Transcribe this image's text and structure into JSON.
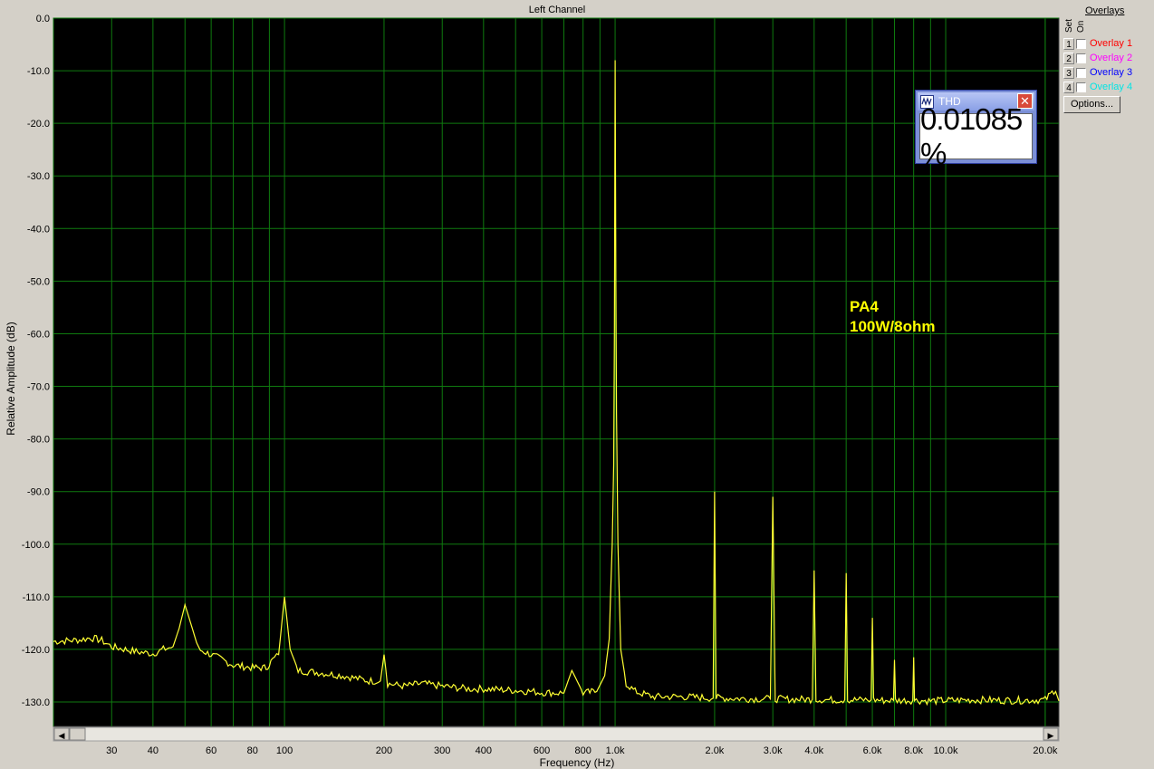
{
  "chart_data": {
    "type": "line",
    "title": "Left Channel",
    "xlabel": "Frequency (Hz)",
    "ylabel": "Relative Amplitude (dB)",
    "x_scale": "log",
    "xlim": [
      20,
      22000
    ],
    "ylim": [
      -135,
      0
    ],
    "grid": true,
    "y_ticks": [
      "0.0",
      "-10.0",
      "-20.0",
      "-30.0",
      "-40.0",
      "-50.0",
      "-60.0",
      "-70.0",
      "-80.0",
      "-90.0",
      "-100.0",
      "-110.0",
      "-120.0",
      "-130.0"
    ],
    "x_ticks": [
      {
        "value": 30,
        "label": "30"
      },
      {
        "value": 40,
        "label": "40"
      },
      {
        "value": 60,
        "label": "60"
      },
      {
        "value": 80,
        "label": "80"
      },
      {
        "value": 100,
        "label": "100"
      },
      {
        "value": 200,
        "label": "200"
      },
      {
        "value": 300,
        "label": "300"
      },
      {
        "value": 400,
        "label": "400"
      },
      {
        "value": 600,
        "label": "600"
      },
      {
        "value": 800,
        "label": "800"
      },
      {
        "value": 1000,
        "label": "1.0k"
      },
      {
        "value": 2000,
        "label": "2.0k"
      },
      {
        "value": 3000,
        "label": "3.0k"
      },
      {
        "value": 4000,
        "label": "4.0k"
      },
      {
        "value": 6000,
        "label": "6.0k"
      },
      {
        "value": 8000,
        "label": "8.0k"
      },
      {
        "value": 10000,
        "label": "10.0k"
      },
      {
        "value": 20000,
        "label": "20.0k"
      }
    ],
    "series": [
      {
        "color": "#ffff33",
        "x": [
          20,
          24,
          26,
          28,
          30,
          33,
          36,
          40,
          43,
          46,
          48,
          50,
          52,
          55,
          60,
          65,
          70,
          80,
          88,
          92,
          96,
          100,
          104,
          110,
          130,
          150,
          180,
          195,
          200,
          205,
          230,
          260,
          300,
          360,
          400,
          500,
          560,
          600,
          700,
          740,
          800,
          880,
          930,
          960,
          980,
          990,
          995,
          1000,
          1005,
          1010,
          1020,
          1040,
          1080,
          1150,
          1300,
          1600,
          1900,
          1980,
          2000,
          2020,
          2200,
          2600,
          2950,
          3000,
          3050,
          3400,
          3950,
          4000,
          4050,
          4500,
          4950,
          5000,
          5050,
          5500,
          5950,
          6000,
          6050,
          6500,
          6950,
          7000,
          7050,
          7500,
          7950,
          8000,
          8050,
          9000,
          12000,
          16000,
          20000,
          21500,
          22000
        ],
        "y": [
          -118.5,
          -118.2,
          -117.8,
          -118.3,
          -119.5,
          -120.0,
          -120.5,
          -120.8,
          -120.0,
          -119.5,
          -116.0,
          -111.5,
          -115.0,
          -120.0,
          -121.0,
          -122.0,
          -123.0,
          -123.5,
          -123.5,
          -122.0,
          -121.0,
          -110.0,
          -120.0,
          -124.0,
          -124.5,
          -125.0,
          -126.0,
          -126.0,
          -121.0,
          -126.5,
          -127.0,
          -126.5,
          -127.0,
          -127.5,
          -127.5,
          -127.8,
          -128.0,
          -128.2,
          -128.3,
          -124.0,
          -128.3,
          -128.0,
          -125.0,
          -118.0,
          -100.0,
          -85.0,
          -60.0,
          -8.0,
          -50.0,
          -75.0,
          -100.0,
          -120.0,
          -126.5,
          -128.0,
          -129.0,
          -129.0,
          -129.2,
          -129.3,
          -90.0,
          -129.2,
          -129.3,
          -129.4,
          -129.4,
          -91.0,
          -129.4,
          -129.5,
          -129.5,
          -105.0,
          -129.5,
          -129.6,
          -129.6,
          -105.5,
          -129.6,
          -129.6,
          -129.6,
          -114.0,
          -129.6,
          -129.7,
          -129.7,
          -122.0,
          -129.7,
          -129.7,
          -129.7,
          -121.5,
          -129.7,
          -129.8,
          -129.6,
          -129.7,
          -129.6,
          -127.5,
          -129.8
        ]
      }
    ],
    "annotations": [
      "PA4",
      "100W/8ohm"
    ]
  },
  "overlays": {
    "title": "Overlays",
    "col_set": "Set",
    "col_on": "On",
    "items": [
      {
        "num": "1",
        "label": "Overlay 1",
        "color": "#ff0000"
      },
      {
        "num": "2",
        "label": "Overlay 2",
        "color": "#ff00ff"
      },
      {
        "num": "3",
        "label": "Overlay 3",
        "color": "#0000ff"
      },
      {
        "num": "4",
        "label": "Overlay 4",
        "color": "#00e5e5"
      }
    ],
    "options_label": "Options..."
  },
  "thd": {
    "title": "THD",
    "close_glyph": "✕",
    "value": "0.01085 %"
  },
  "scrollbar": {
    "left_arrow": "◀",
    "right_arrow": "▶"
  }
}
